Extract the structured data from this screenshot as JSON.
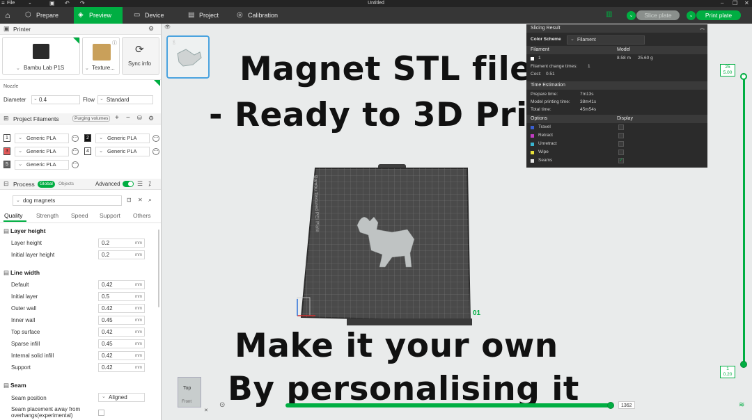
{
  "window": {
    "title": "Untitled",
    "file_menu": "File"
  },
  "nav": {
    "tabs": [
      {
        "label": "Prepare",
        "icon": "prepare-icon"
      },
      {
        "label": "Preview",
        "icon": "preview-icon",
        "active": true
      },
      {
        "label": "Device",
        "icon": "device-icon"
      },
      {
        "label": "Project",
        "icon": "project-icon"
      },
      {
        "label": "Calibration",
        "icon": "calibration-icon"
      }
    ],
    "slice_plate": "Slice plate",
    "print_plate": "Print plate",
    "accent_color": "#00ae42"
  },
  "printer": {
    "section_title": "Printer",
    "printer_name": "Bambu Lab P1S",
    "plate_name": "Texture...",
    "sync_info": "Sync info",
    "nozzle_label": "Nozzle",
    "diameter_label": "Diameter",
    "diameter_value": "0.4",
    "flow_label": "Flow",
    "flow_value": "Standard"
  },
  "filaments": {
    "section_title": "Project Filaments",
    "purging": "Purging volumes",
    "items": [
      {
        "num": "1",
        "name": "Generic PLA",
        "color": "#ffffff"
      },
      {
        "num": "2",
        "name": "Generic PLA",
        "color": "#111111"
      },
      {
        "num": "3",
        "name": "Generic PLA",
        "color": "#e85a5a"
      },
      {
        "num": "4",
        "name": "Generic PLA",
        "color": "#ffffff"
      },
      {
        "num": "5",
        "name": "Generic PLA",
        "color": "#666666"
      }
    ]
  },
  "process": {
    "section_title": "Process",
    "global": "Global",
    "objects": "Objects",
    "advanced": "Advanced",
    "preset": "dog magnets",
    "tabs": [
      "Quality",
      "Strength",
      "Speed",
      "Support",
      "Others"
    ],
    "layer_height_group": "Layer height",
    "layer_height": [
      {
        "label": "Layer height",
        "value": "0.2",
        "unit": "mm"
      },
      {
        "label": "Initial layer height",
        "value": "0.2",
        "unit": "mm"
      }
    ],
    "line_width_group": "Line width",
    "line_width": [
      {
        "label": "Default",
        "value": "0.42",
        "unit": "mm"
      },
      {
        "label": "Initial layer",
        "value": "0.5",
        "unit": "mm"
      },
      {
        "label": "Outer wall",
        "value": "0.42",
        "unit": "mm"
      },
      {
        "label": "Inner wall",
        "value": "0.45",
        "unit": "mm"
      },
      {
        "label": "Top surface",
        "value": "0.42",
        "unit": "mm"
      },
      {
        "label": "Sparse infill",
        "value": "0.45",
        "unit": "mm"
      },
      {
        "label": "Internal solid infill",
        "value": "0.42",
        "unit": "mm"
      },
      {
        "label": "Support",
        "value": "0.42",
        "unit": "mm"
      }
    ],
    "seam_group": "Seam",
    "seam_position_label": "Seam position",
    "seam_position_value": "Aligned",
    "seam_away_label": "Seam placement away from overhangs(experimental)"
  },
  "overlay": {
    "line1": "Magnet STL file",
    "line2": "- Ready to 3D Print",
    "line3": "Make it your own",
    "line4": "By personalising it"
  },
  "viewport": {
    "plate_label": "Bambu Textured PEI Plate",
    "plate_number": "01",
    "thumb_number": "1",
    "cube_top": "Top",
    "cube_front": "Front"
  },
  "slicing": {
    "title": "Slicing Result",
    "color_scheme_label": "Color Scheme",
    "color_scheme_value": "Filament",
    "filament_header": "Filament",
    "model_header": "Model",
    "filament_row": {
      "num": "1",
      "length": "8.58 m",
      "weight": "25.60 g"
    },
    "change_times_label": "Filament change times:",
    "change_times_value": "1",
    "cost_label": "Cost:",
    "cost_value": "0.51",
    "time_header": "Time Estimation",
    "prepare_label": "Prepare time:",
    "prepare_value": "7m13s",
    "model_time_label": "Model printing time:",
    "model_time_value": "38m41s",
    "total_label": "Total time:",
    "total_value": "45m54s",
    "options_header": "Options",
    "display_header": "Display",
    "options": [
      {
        "label": "Travel",
        "color": "#3a5fd0",
        "checked": false
      },
      {
        "label": "Retract",
        "color": "#c23cc2",
        "checked": false
      },
      {
        "label": "Unretract",
        "color": "#3ab5d0",
        "checked": false
      },
      {
        "label": "Wipe",
        "color": "#e8e03a",
        "checked": false
      },
      {
        "label": "Seams",
        "color": "#e6e6e6",
        "checked": true
      }
    ]
  },
  "layers": {
    "top_layer": "25",
    "top_height": "5.00",
    "bottom_layer": "1",
    "bottom_height": "0.20",
    "move_value": "1362"
  }
}
